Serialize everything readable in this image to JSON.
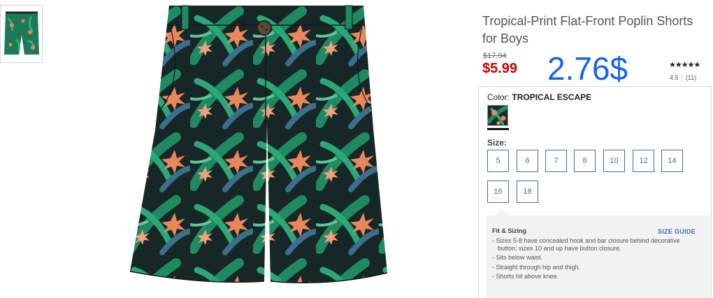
{
  "product": {
    "title": "Tropical-Print Flat-Front Poplin Shorts for Boys",
    "old_price": "$17.94",
    "price": "$5.99",
    "overlay_price": "2.76$",
    "stars": "★★★★★",
    "rating_value": "4.5",
    "review_count": "(11)"
  },
  "color": {
    "label": "Color:",
    "name": "TROPICAL ESCAPE"
  },
  "size": {
    "label": "Size:",
    "options": [
      "5",
      "6",
      "7",
      "8",
      "10",
      "12",
      "14",
      "16",
      "18"
    ]
  },
  "fit": {
    "title": "Fit & Sizing",
    "guide_link": "SIZE GUIDE",
    "items": [
      "- Sizes 5-8 have concealed hook and bar closure behind decorative button; sizes 10 and up have button closure.",
      "- Sits below waist.",
      "- Straight through hip and thigh.",
      "- Shorts hit above knee."
    ]
  },
  "colors": {
    "price_red": "#cc0000",
    "overlay_blue": "#1565e8",
    "link_blue": "#3d6fb0",
    "fabric_dark": "#1a2a2a",
    "fabric_green": "#1f8a62",
    "fabric_orange": "#e8875a"
  }
}
